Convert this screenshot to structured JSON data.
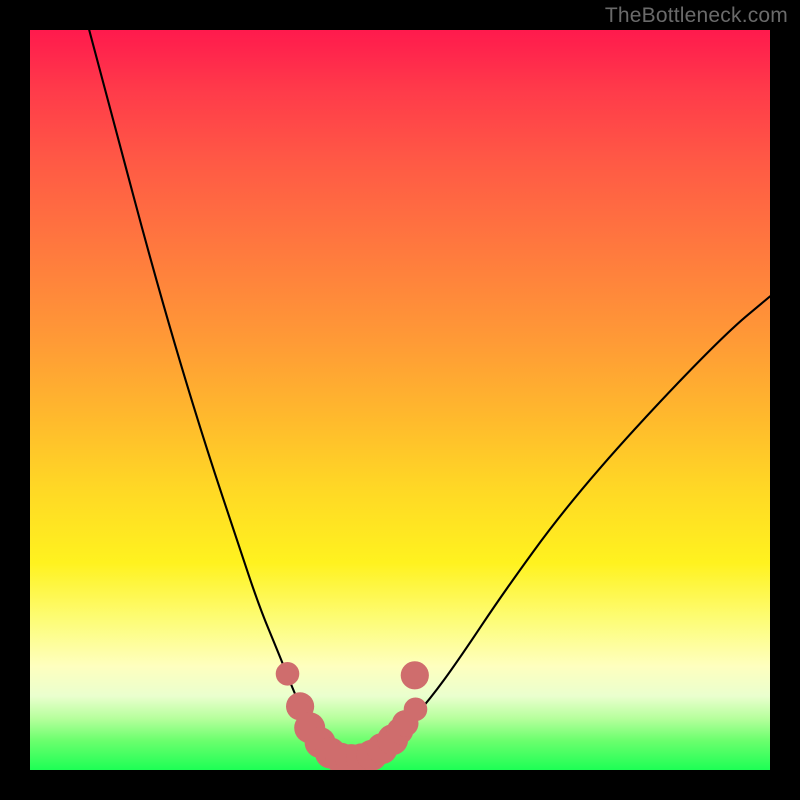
{
  "watermark": {
    "text": "TheBottleneck.com"
  },
  "chart_data": {
    "type": "line",
    "title": "",
    "xlabel": "",
    "ylabel": "",
    "xlim": [
      0,
      100
    ],
    "ylim": [
      0,
      100
    ],
    "series": [
      {
        "name": "bottleneck-curve",
        "x": [
          8,
          12,
          16,
          20,
          24,
          28,
          31,
          33.5,
          35.5,
          37,
          38.5,
          40,
          41.5,
          43,
          44.5,
          46,
          48,
          50,
          54,
          58,
          64,
          72,
          82,
          94,
          100
        ],
        "y": [
          100,
          85,
          70,
          56,
          43,
          31,
          22,
          16,
          11,
          7.5,
          5,
          3,
          2,
          1.4,
          1.4,
          2,
          3.2,
          5,
          9.5,
          15,
          24,
          35,
          46.5,
          59,
          64
        ]
      }
    ],
    "markers": {
      "name": "highlight-dots",
      "color": "#cf6d6d",
      "points": [
        {
          "x": 34.8,
          "y": 13.0,
          "r": 1.6
        },
        {
          "x": 36.5,
          "y": 8.6,
          "r": 1.9
        },
        {
          "x": 37.8,
          "y": 5.7,
          "r": 2.1
        },
        {
          "x": 39.2,
          "y": 3.7,
          "r": 2.1
        },
        {
          "x": 40.6,
          "y": 2.3,
          "r": 2.1
        },
        {
          "x": 42.0,
          "y": 1.6,
          "r": 2.1
        },
        {
          "x": 43.4,
          "y": 1.4,
          "r": 2.1
        },
        {
          "x": 44.8,
          "y": 1.5,
          "r": 2.1
        },
        {
          "x": 46.2,
          "y": 2.0,
          "r": 2.1
        },
        {
          "x": 47.6,
          "y": 2.9,
          "r": 2.1
        },
        {
          "x": 49.0,
          "y": 4.1,
          "r": 2.1
        },
        {
          "x": 50.0,
          "y": 5.3,
          "r": 1.8
        },
        {
          "x": 50.7,
          "y": 6.3,
          "r": 1.8
        },
        {
          "x": 52.1,
          "y": 8.2,
          "r": 1.6
        },
        {
          "x": 52.0,
          "y": 12.8,
          "r": 1.9
        }
      ]
    },
    "background_gradient": {
      "top": "#ff1a4d",
      "mid": "#ffe033",
      "bottom": "#1dff55"
    }
  }
}
